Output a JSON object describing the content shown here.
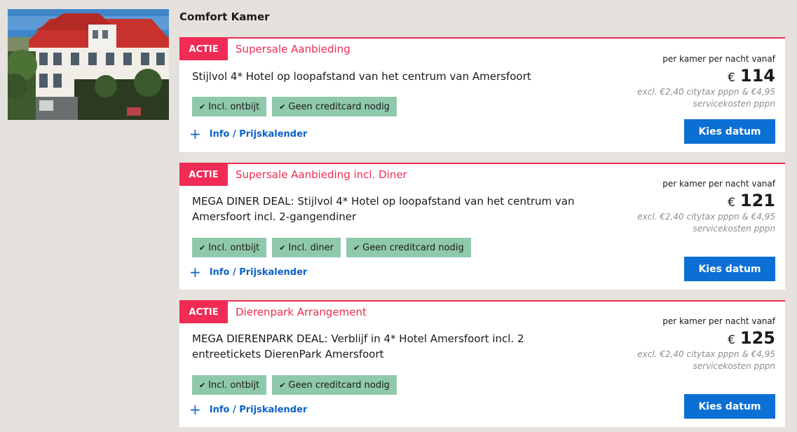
{
  "room": {
    "title": "Comfort Kamer"
  },
  "photo": {
    "icon": "hotel-photo"
  },
  "offers": [
    {
      "badge": "ACTIE",
      "name": "Supersale Aanbieding",
      "description": "Stijlvol 4* Hotel op loopafstand van het centrum van Amersfoort",
      "tags": [
        "Incl. ontbijt",
        "Geen creditcard nodig"
      ],
      "info_label": "Info / Prijskalender",
      "per_label": "per kamer per nacht vanaf",
      "currency": "€",
      "price": "114",
      "excl_note": "excl. €2,40 citytax pppn & €4,95 servicekosten pppn",
      "button": "Kies datum"
    },
    {
      "badge": "ACTIE",
      "name": "Supersale Aanbieding incl. Diner",
      "description": "MEGA DINER DEAL: Stijlvol 4* Hotel op loopafstand van het centrum van Amersfoort incl. 2-gangendiner",
      "tags": [
        "Incl. ontbijt",
        "Incl. diner",
        "Geen creditcard nodig"
      ],
      "info_label": "Info / Prijskalender",
      "per_label": "per kamer per nacht vanaf",
      "currency": "€",
      "price": "121",
      "excl_note": "excl. €2,40 citytax pppn & €4,95 servicekosten pppn",
      "button": "Kies datum"
    },
    {
      "badge": "ACTIE",
      "name": "Dierenpark Arrangement",
      "description": "MEGA DIERENPARK DEAL: Verblijf in 4* Hotel Amersfoort incl. 2 entreetickets DierenPark Amersfoort",
      "tags": [
        "Incl. ontbijt",
        "Geen creditcard nodig"
      ],
      "info_label": "Info / Prijskalender",
      "per_label": "per kamer per nacht vanaf",
      "currency": "€",
      "price": "125",
      "excl_note": "excl. €2,40 citytax pppn & €4,95 servicekosten pppn",
      "button": "Kies datum"
    }
  ],
  "colors": {
    "accent": "#f02b55",
    "button": "#0b6fd4",
    "tag": "#8fc9ab",
    "link": "#0b63c9",
    "background": "#e5e1dc"
  }
}
